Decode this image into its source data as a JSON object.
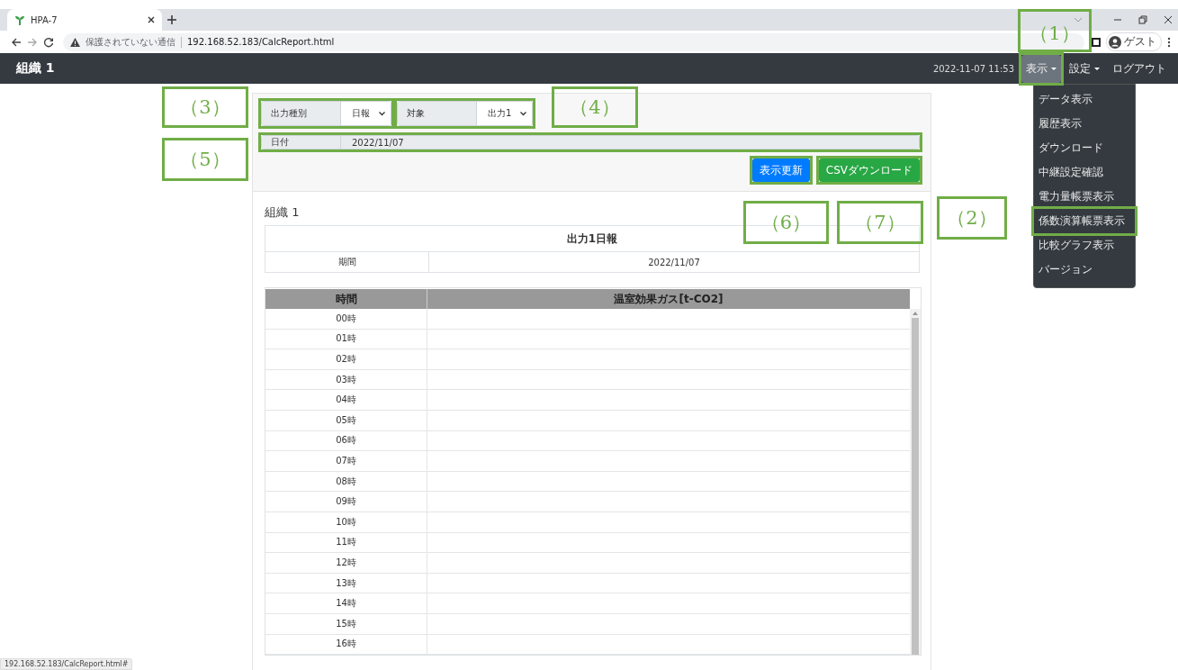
{
  "browser": {
    "tab_title": "HPA-7",
    "security_label": "保護されていない通信",
    "url": "192.168.52.183/CalcReport.html",
    "profile_label": "ゲスト",
    "status_url": "192.168.52.183/CalcReport.html#"
  },
  "navbar": {
    "brand": "組織 1",
    "datetime": "2022-11-07 11:53",
    "menus": [
      {
        "label": "表示",
        "kind": "dropdown",
        "selected": true
      },
      {
        "label": "設定",
        "kind": "dropdown",
        "selected": false
      },
      {
        "label": "ログアウト",
        "kind": "link",
        "selected": false
      }
    ]
  },
  "dropdown_menu": {
    "items": [
      "データ表示",
      "履歴表示",
      "ダウンロード",
      "中継設定確認",
      "電力量帳票表示",
      "係数演算帳票表示",
      "比較グラフ表示",
      "バージョン"
    ]
  },
  "form": {
    "output_type": {
      "label": "出力種別",
      "value": "日報"
    },
    "target": {
      "label": "対象",
      "value": "出力1"
    },
    "date": {
      "label": "日付",
      "value": "2022/11/07"
    },
    "buttons": [
      {
        "label": "表示更新",
        "kind": "primary"
      },
      {
        "label": "CSVダウンロード",
        "kind": "success"
      }
    ]
  },
  "report": {
    "organization": "組織 1",
    "title": "出力1日報",
    "period_label": "期間",
    "period_value": "2022/11/07",
    "columns": [
      "時間",
      "温室効果ガス[t-CO2]"
    ],
    "rows": [
      "00時",
      "01時",
      "02時",
      "03時",
      "04時",
      "05時",
      "06時",
      "07時",
      "08時",
      "09時",
      "10時",
      "11時",
      "12時",
      "13時",
      "14時",
      "15時",
      "16時"
    ]
  },
  "annotations": [
    {
      "label": "（1）"
    },
    {
      "label": "（2）"
    },
    {
      "label": "（3）"
    },
    {
      "label": "（4）"
    },
    {
      "label": "（5）"
    },
    {
      "label": "（6）"
    },
    {
      "label": "（7）"
    }
  ]
}
